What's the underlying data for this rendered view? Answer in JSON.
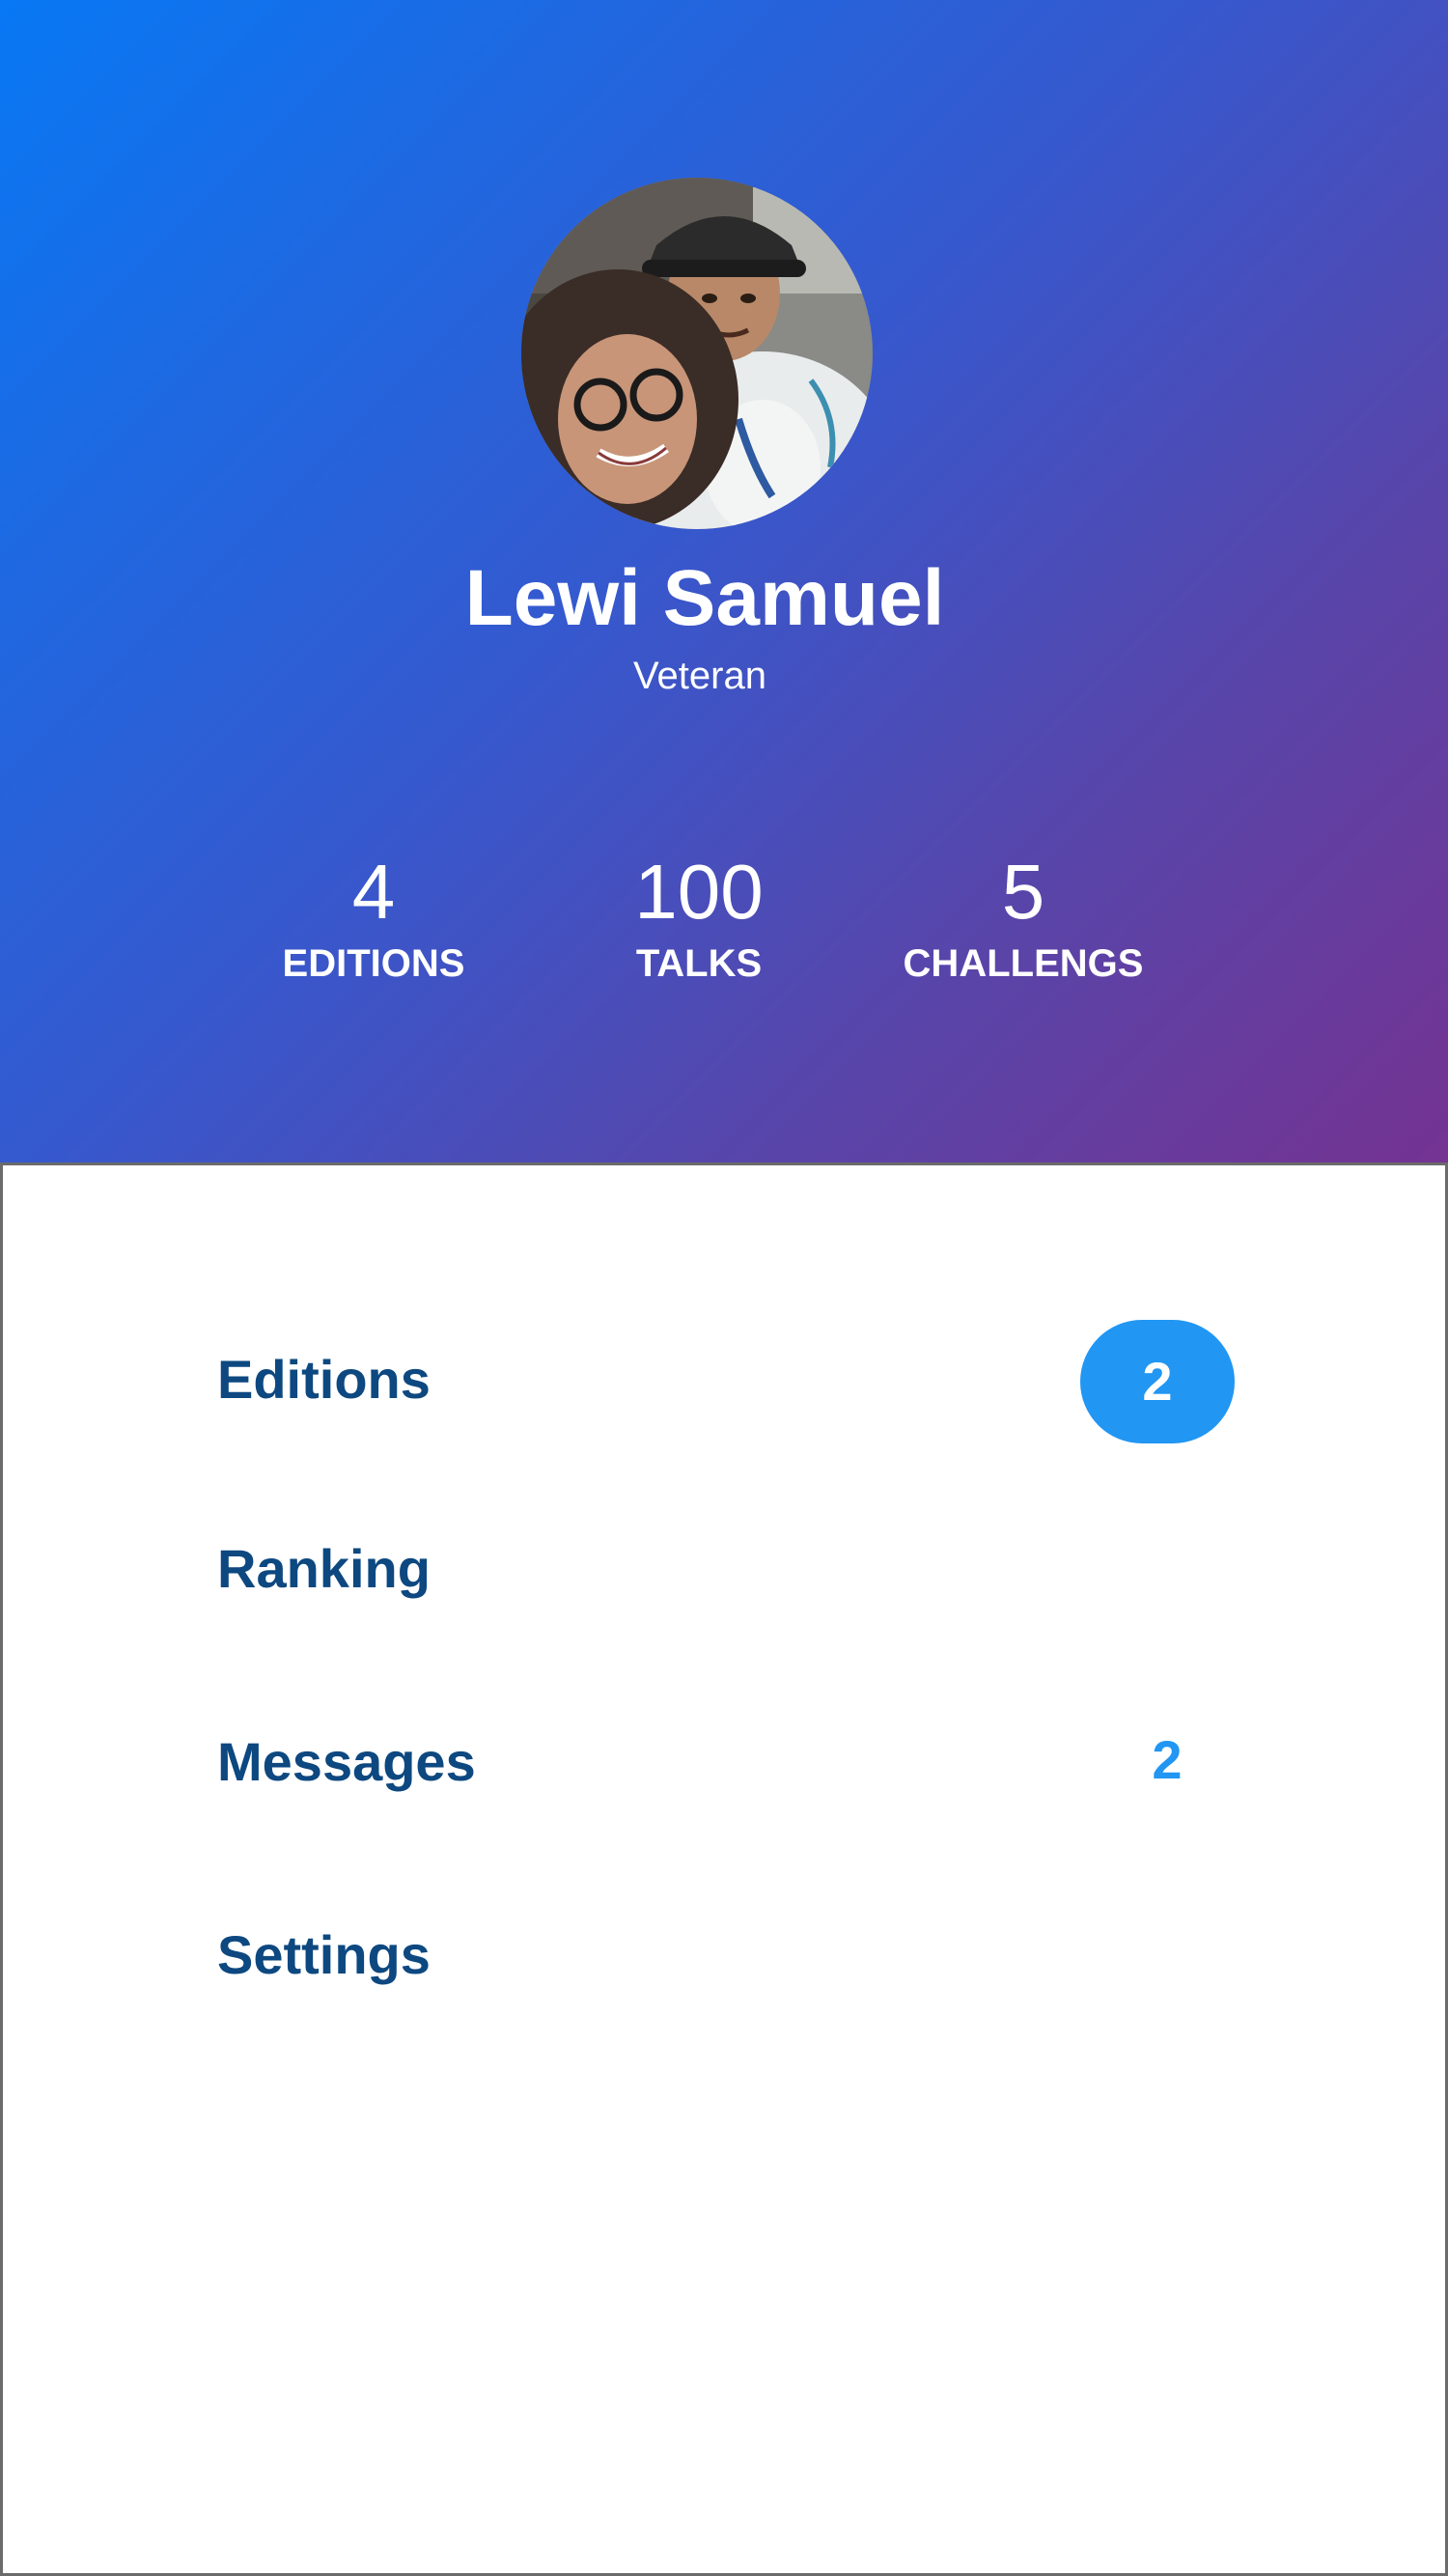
{
  "profile": {
    "name": "Lewi Samuel",
    "subtitle": "Veteran"
  },
  "stats": [
    {
      "value": "4",
      "label": "EDITIONS"
    },
    {
      "value": "100",
      "label": "TALKS"
    },
    {
      "value": "5",
      "label": "CHALLENGS"
    }
  ],
  "menu": [
    {
      "label": "Editions",
      "badge": "2"
    },
    {
      "label": "Ranking"
    },
    {
      "label": "Messages",
      "count": "2"
    },
    {
      "label": "Settings"
    }
  ],
  "colors": {
    "gradient_start": "#0878f4",
    "gradient_end": "#743392",
    "menu_text": "#0d4880",
    "accent": "#2196f3",
    "panel_border": "#6b6b6b"
  },
  "icons": {
    "avatar": "profile-photo"
  }
}
